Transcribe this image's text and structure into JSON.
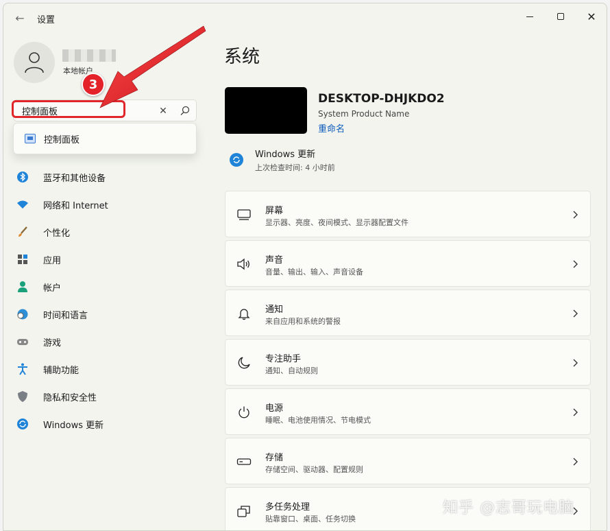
{
  "window": {
    "title": "设置",
    "back_icon": "arrow-left-icon"
  },
  "profile": {
    "account_type": "本地帐户"
  },
  "search": {
    "value": "控制面板",
    "clear_icon": "close-icon",
    "search_icon": "search-icon"
  },
  "annotation": {
    "step": "3",
    "color": "#e0262b"
  },
  "suggestion": {
    "label": "控制面板",
    "icon": "control-panel-icon"
  },
  "nav": {
    "items": [
      {
        "label": "蓝牙和其他设备",
        "icon": "bluetooth-icon"
      },
      {
        "label": "网络和 Internet",
        "icon": "wifi-icon"
      },
      {
        "label": "个性化",
        "icon": "brush-icon"
      },
      {
        "label": "应用",
        "icon": "apps-icon"
      },
      {
        "label": "帐户",
        "icon": "person-icon"
      },
      {
        "label": "时间和语言",
        "icon": "globe-clock-icon"
      },
      {
        "label": "游戏",
        "icon": "gamepad-icon"
      },
      {
        "label": "辅助功能",
        "icon": "accessibility-icon"
      },
      {
        "label": "隐私和安全性",
        "icon": "shield-icon"
      },
      {
        "label": "Windows 更新",
        "icon": "update-icon"
      }
    ]
  },
  "main": {
    "title": "系统",
    "device": {
      "name": "DESKTOP-DHJKDO2",
      "model": "System Product Name",
      "rename": "重命名"
    },
    "update": {
      "title": "Windows 更新",
      "subtitle": "上次检查时间: 4 小时前"
    },
    "cards": [
      {
        "title": "屏幕",
        "subtitle": "显示器、亮度、夜间模式、显示器配置文件",
        "icon": "monitor-icon"
      },
      {
        "title": "声音",
        "subtitle": "音量、输出、输入、声音设备",
        "icon": "speaker-icon"
      },
      {
        "title": "通知",
        "subtitle": "来自应用和系统的警报",
        "icon": "bell-icon"
      },
      {
        "title": "专注助手",
        "subtitle": "通知、自动规则",
        "icon": "moon-icon"
      },
      {
        "title": "电源",
        "subtitle": "睡眠、电池使用情况、节电模式",
        "icon": "power-icon"
      },
      {
        "title": "存储",
        "subtitle": "存储空间、驱动器、配置规则",
        "icon": "storage-icon"
      },
      {
        "title": "多任务处理",
        "subtitle": "贴靠窗口、桌面、任务切换",
        "icon": "multitask-icon"
      }
    ]
  },
  "watermark": "知乎 @志哥玩电脑",
  "colors": {
    "accent": "#0c5cbc",
    "update_blue": "#1f84d8",
    "annotation_red": "#e3222a"
  }
}
